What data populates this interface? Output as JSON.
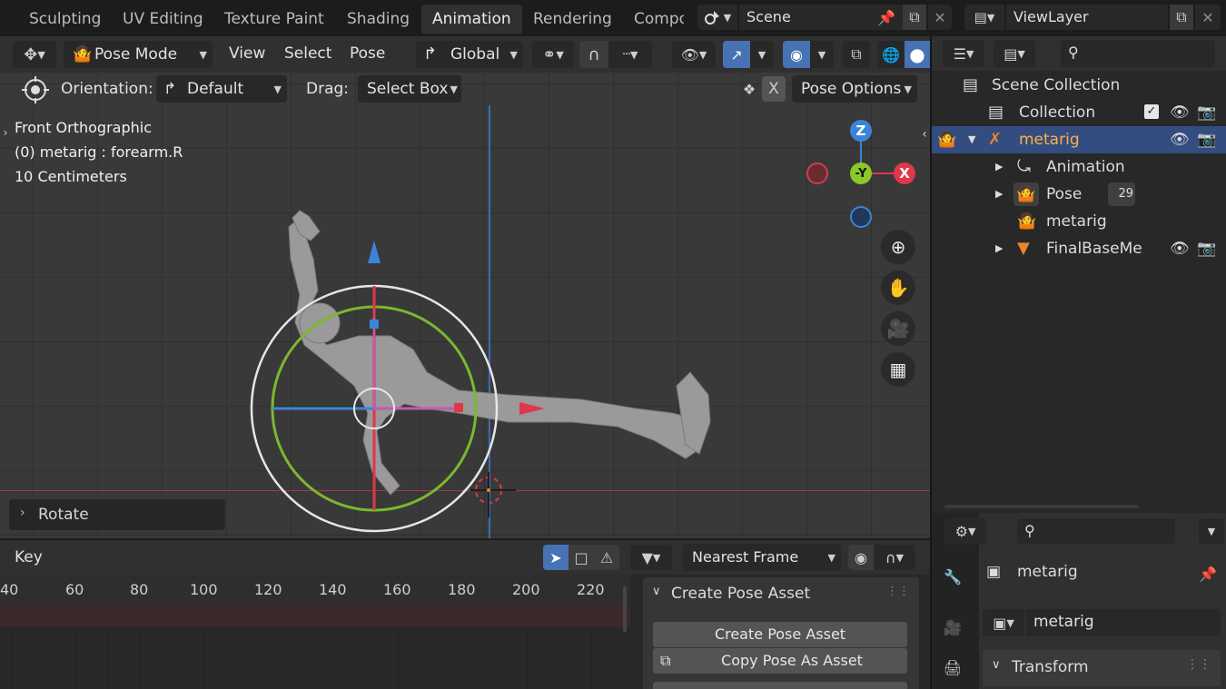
{
  "workspace_tabs": [
    "Sculpting",
    "UV Editing",
    "Texture Paint",
    "Shading",
    "Animation",
    "Rendering",
    "Compo"
  ],
  "active_tab": "Animation",
  "scene": {
    "label": "Scene",
    "view_layer": "ViewLayer"
  },
  "viewport_header": {
    "mode": "Pose Mode",
    "menus": [
      "View",
      "Select",
      "Pose"
    ],
    "transform_orientation": "Global"
  },
  "tool_settings": {
    "orientation_label": "Orientation:",
    "orientation_value": "Default",
    "drag_label": "Drag:",
    "drag_value": "Select Box",
    "x_label": "X",
    "pose_options": "Pose Options"
  },
  "overlay_text": {
    "line1": "Front Orthographic",
    "line2": "(0) metarig : forearm.R",
    "line3": "10 Centimeters"
  },
  "gizmo": {
    "z": "Z",
    "y": "-Y",
    "x": "X"
  },
  "last_op": "Rotate",
  "outliner": {
    "items": [
      {
        "label": "Scene Collection"
      },
      {
        "label": "Collection"
      },
      {
        "label": "metarig"
      },
      {
        "label": "Animation"
      },
      {
        "label": "Pose",
        "badge": "29"
      },
      {
        "label": "metarig"
      },
      {
        "label": "FinalBaseMe"
      }
    ]
  },
  "timeline": {
    "label": "Key",
    "snap": "Nearest Frame",
    "frames": [
      "40",
      "60",
      "80",
      "100",
      "120",
      "140",
      "160",
      "180",
      "200",
      "220"
    ]
  },
  "pose_library": {
    "header": "Create Pose Asset",
    "btn1": "Create Pose Asset",
    "btn2": "Copy Pose As Asset"
  },
  "properties": {
    "object_name": "metarig",
    "data_name": "metarig",
    "section": "Transform"
  },
  "colors": {
    "accent": "#4772b3",
    "selection": "#334d80",
    "gizmo_x": "#e0374b",
    "gizmo_y": "#8ac926",
    "gizmo_z": "#3a85d8",
    "orange": "#e8852a"
  }
}
